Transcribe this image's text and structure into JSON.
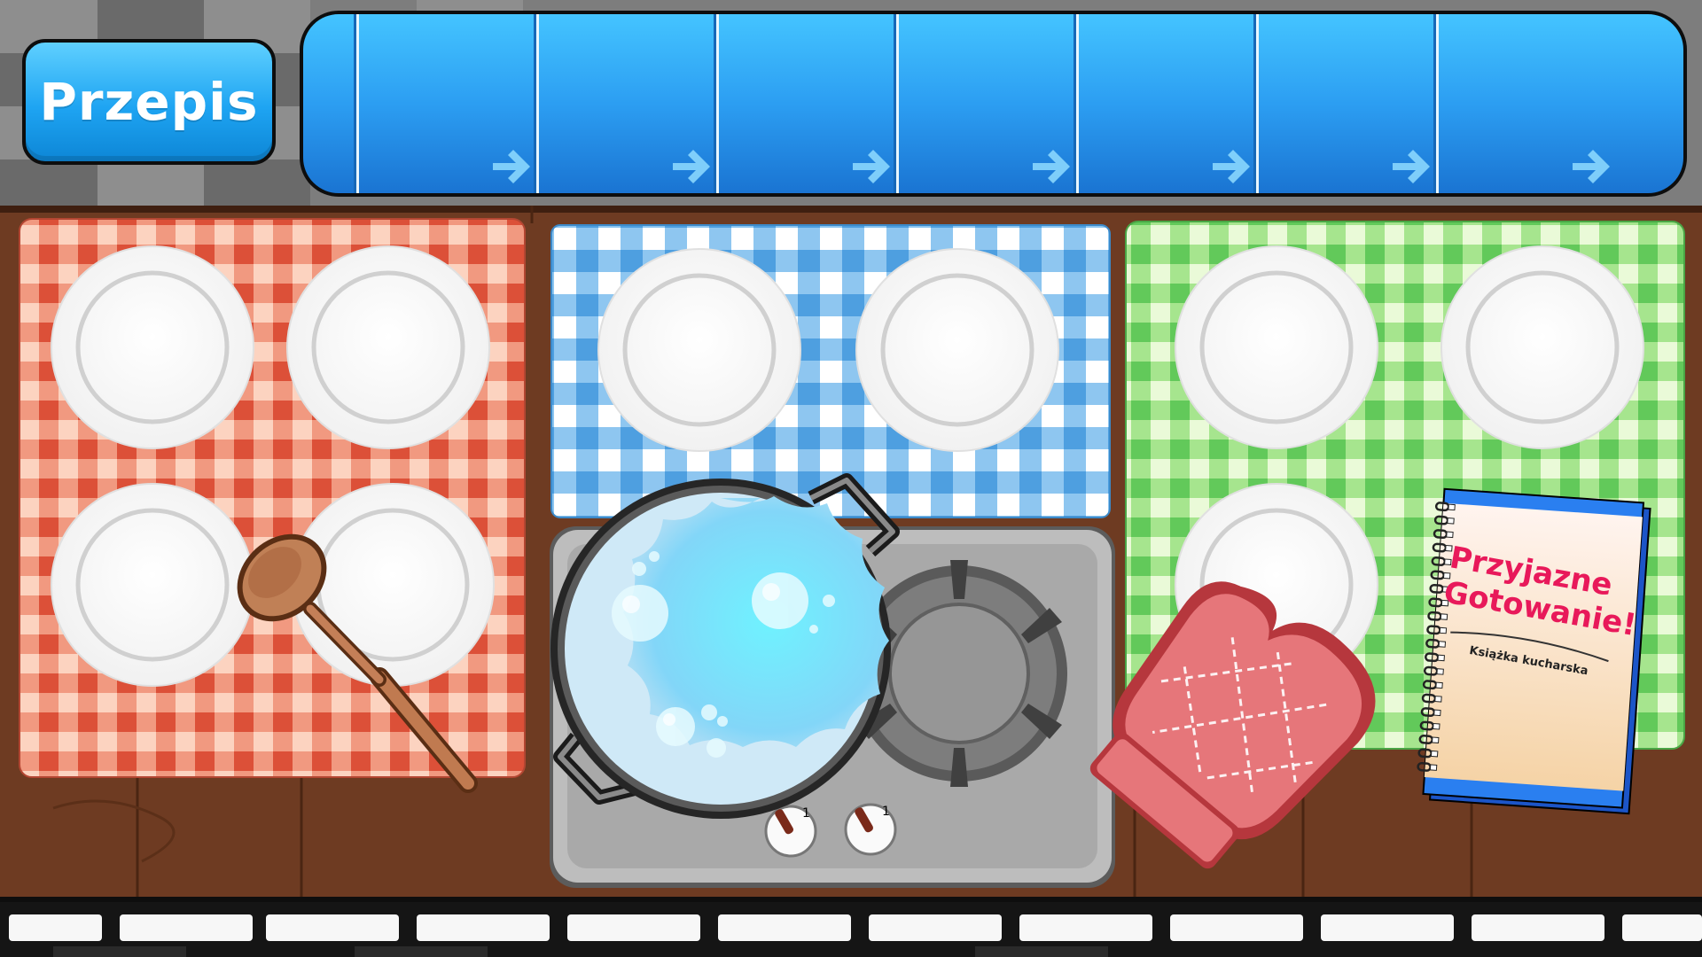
{
  "header": {
    "recipe_button_label": "Przepis",
    "step_slots": [
      {
        "arrow_icon": "arrow-right-icon"
      },
      {
        "arrow_icon": "arrow-right-icon"
      },
      {
        "arrow_icon": "arrow-right-icon"
      },
      {
        "arrow_icon": "arrow-right-icon"
      },
      {
        "arrow_icon": "arrow-right-icon"
      },
      {
        "arrow_icon": "arrow-right-icon"
      },
      {
        "arrow_icon": "arrow-right-icon"
      }
    ]
  },
  "tablecloths": [
    {
      "color": "red",
      "plates": 4
    },
    {
      "color": "blue",
      "plates": 2
    },
    {
      "color": "green",
      "plates": 3
    }
  ],
  "stove": {
    "knob_left_value": "1",
    "knob_right_value": "1",
    "pot_contents": "boiling water"
  },
  "cookbook": {
    "title_line1": "Przyjazne",
    "title_line2": "Gotowanie!",
    "subtitle": "Książka kucharska"
  },
  "items": [
    "wooden-spoon-icon",
    "oven-mitt-icon"
  ],
  "colors": {
    "button_blue": "#1ea4f2",
    "red_cloth": "#e05a43",
    "blue_cloth": "#5aaae6",
    "green_cloth": "#6dd36a",
    "wood": "#6e3b22",
    "mitt": "#e4676b",
    "cookbook_title": "#e8195a"
  }
}
